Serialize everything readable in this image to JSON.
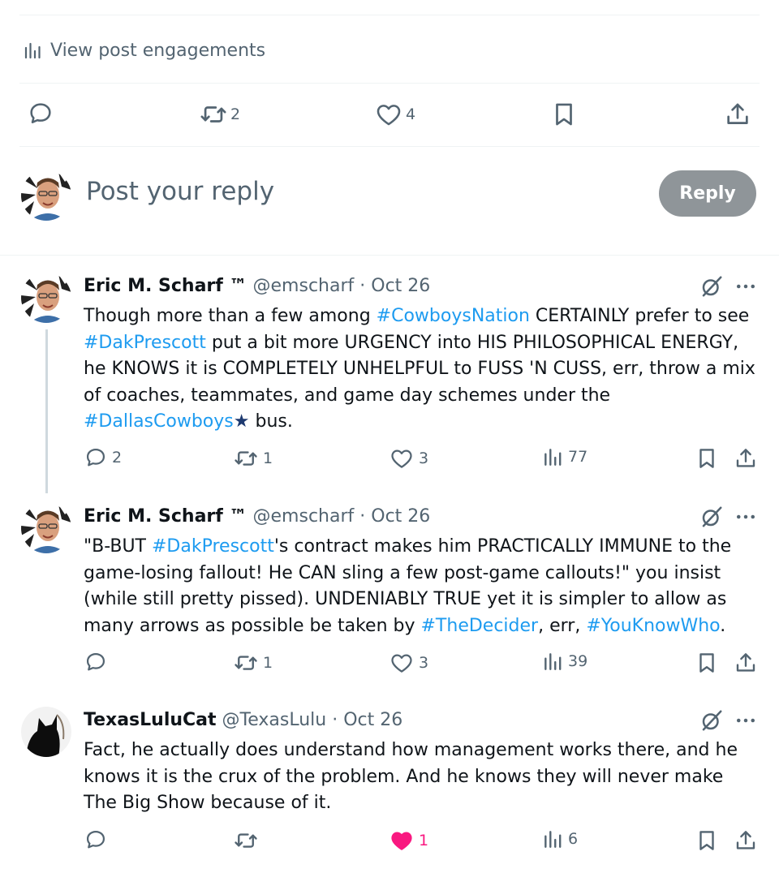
{
  "engagements": {
    "label": "View post engagements",
    "icon": "bar-chart-icon"
  },
  "main_actions": {
    "reply_count": "",
    "repost_count": "2",
    "like_count": "4"
  },
  "composer": {
    "placeholder": "Post your reply",
    "button_label": "Reply"
  },
  "tweets": [
    {
      "name": "Eric M. Scharf ™",
      "handle": "@emscharf",
      "separator": "·",
      "date": "Oct 26",
      "segments": [
        {
          "t": "Though more than a few among ",
          "h": false
        },
        {
          "t": "#CowboysNation",
          "h": true
        },
        {
          "t": " CERTAINLY prefer to see ",
          "h": false
        },
        {
          "t": "#DakPrescott",
          "h": true
        },
        {
          "t": " put a bit more URGENCY into HIS PHILOSOPHICAL ENERGY, he KNOWS it is COMPLETELY UNHELPFUL to FUSS 'N CUSS, err, throw a mix of coaches, teammates, and game day schemes under the ",
          "h": false
        },
        {
          "t": "#DallasCowboys",
          "h": true
        },
        {
          "t": "★",
          "star": true
        },
        {
          "t": " bus.",
          "h": false
        }
      ],
      "replies": "2",
      "reposts": "1",
      "likes": "3",
      "views": "77",
      "liked": false
    },
    {
      "name": "Eric M. Scharf ™",
      "handle": "@emscharf",
      "separator": "·",
      "date": "Oct 26",
      "segments": [
        {
          "t": "\"B-BUT ",
          "h": false
        },
        {
          "t": "#DakPrescott",
          "h": true
        },
        {
          "t": "'s contract makes him PRACTICALLY IMMUNE to the game-losing fallout! He CAN sling a few post-game callouts!\" you insist (while still pretty pissed). UNDENIABLY TRUE yet it is simpler to allow as many arrows as possible be taken by ",
          "h": false
        },
        {
          "t": "#TheDecider",
          "h": true
        },
        {
          "t": ", err, ",
          "h": false
        },
        {
          "t": "#YouKnowWho",
          "h": true
        },
        {
          "t": ".",
          "h": false
        }
      ],
      "replies": "",
      "reposts": "1",
      "likes": "3",
      "views": "39",
      "liked": false
    },
    {
      "name": "TexasLuluCat",
      "handle": "@TexasLulu",
      "separator": "·",
      "date": "Oct 26",
      "segments": [
        {
          "t": "Fact, he actually does understand how management works there, and he knows it is the crux of the problem. And he knows they will never make The Big Show because of it.",
          "h": false
        }
      ],
      "replies": "",
      "reposts": "",
      "likes": "1",
      "views": "6",
      "liked": true
    }
  ],
  "colors": {
    "accent": "#1d9bf0",
    "secondary_text": "#536471",
    "like_active": "#f91880",
    "reply_button_bg": "#8f9599",
    "star": "#1e3a70"
  }
}
